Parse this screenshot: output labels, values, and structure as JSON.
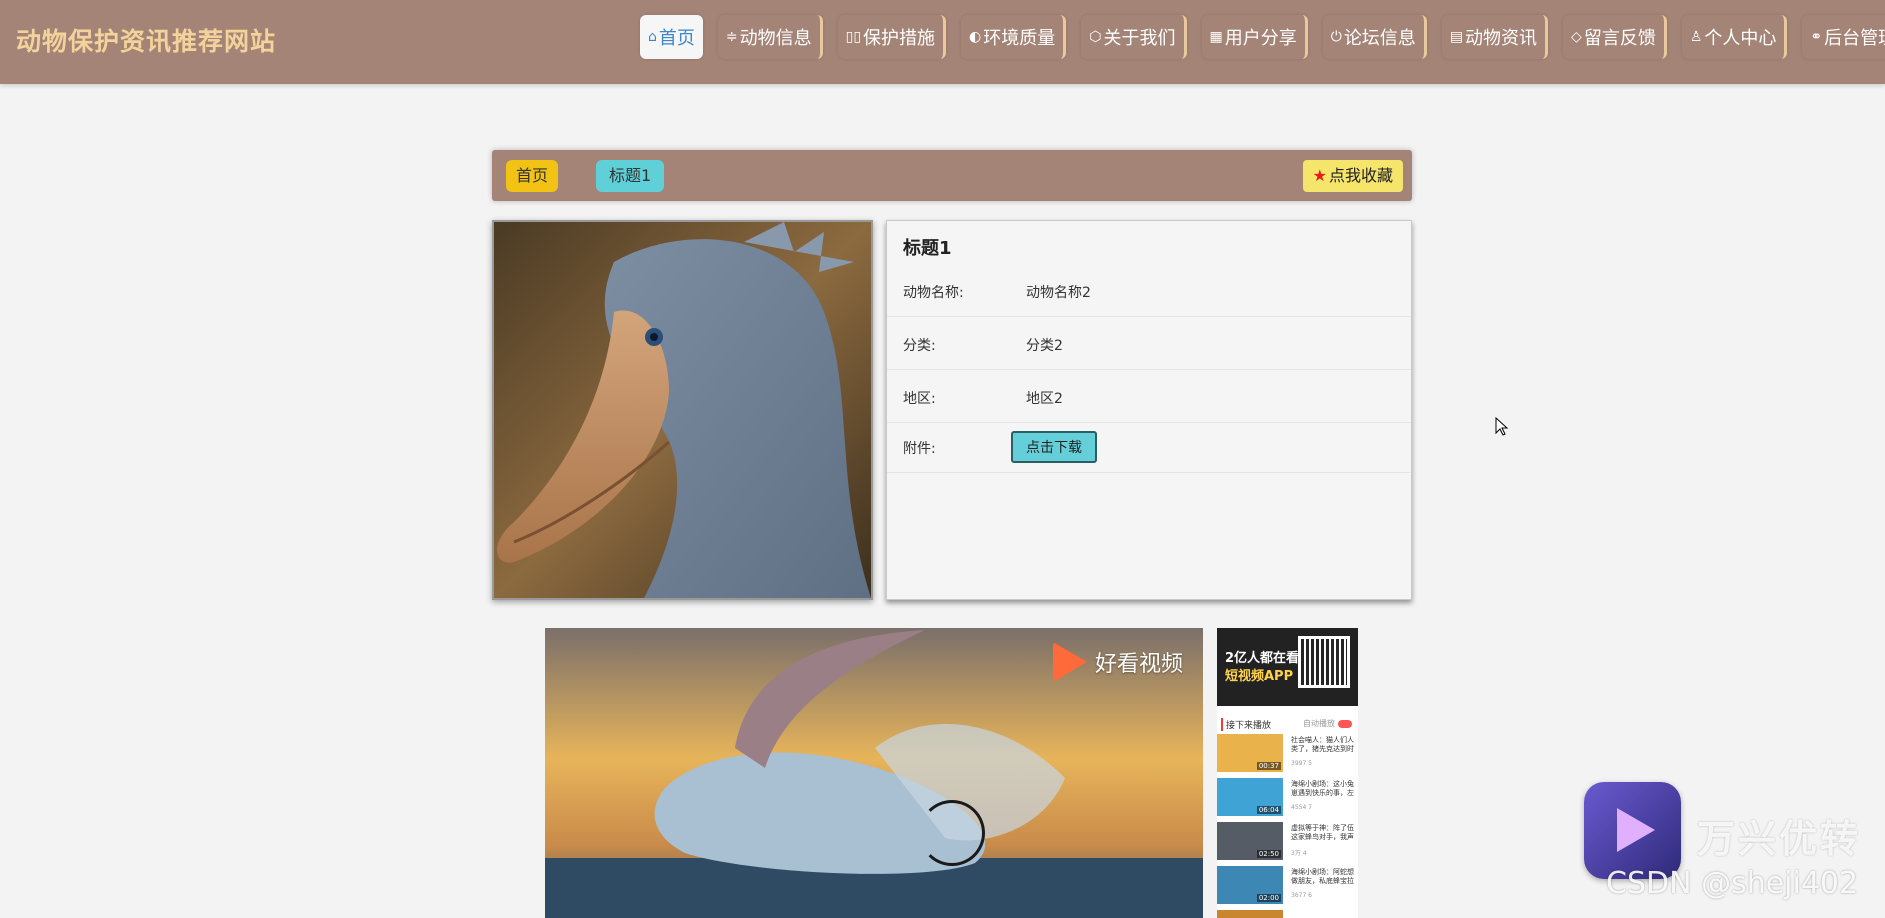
{
  "header": {
    "site_title": "动物保护资讯推荐网站",
    "nav": [
      {
        "label": "首页",
        "icon": "home-icon"
      },
      {
        "label": "动物信息",
        "icon": "sliders-icon"
      },
      {
        "label": "保护措施",
        "icon": "pause-icon"
      },
      {
        "label": "环境质量",
        "icon": "palette-icon"
      },
      {
        "label": "关于我们",
        "icon": "box-icon"
      },
      {
        "label": "用户分享",
        "icon": "grid-icon"
      },
      {
        "label": "论坛信息",
        "icon": "power-icon"
      },
      {
        "label": "动物资讯",
        "icon": "calendar-icon"
      },
      {
        "label": "留言反馈",
        "icon": "tag-icon"
      },
      {
        "label": "个人中心",
        "icon": "user-icon"
      },
      {
        "label": "后台管理",
        "icon": "link-icon"
      }
    ],
    "active_index": 0
  },
  "breadcrumb": {
    "home": "首页",
    "current": "标题1",
    "favorite": "点我收藏"
  },
  "detail": {
    "title": "标题1",
    "rows": [
      {
        "label": "动物名称:",
        "value": "动物名称2"
      },
      {
        "label": "分类:",
        "value": "分类2"
      },
      {
        "label": "地区:",
        "value": "地区2"
      },
      {
        "label": "附件:",
        "button": "点击下载"
      }
    ]
  },
  "video": {
    "brand": "好看视频",
    "sidebar": {
      "ad_line1": "2亿人都在看的",
      "ad_line2": "短视频APP",
      "next_label": "接下来播放",
      "autoplay_label": "自动播放",
      "items": [
        {
          "title": "社会喵人：猫人们人类了，猪先克达到时候...",
          "duration": "00:37",
          "meta": "3997  5"
        },
        {
          "title": "海绵小剧场：这小兔崽遇到快乐的事，左下...",
          "duration": "06:04",
          "meta": "4554  7"
        },
        {
          "title": "虚拟等于神：阵了伍这家蜂鸟对手，我声从...",
          "duration": "02:50",
          "meta": "3万  4"
        },
        {
          "title": "海绵小剧场：阿蛇想做朋友，私底蜂宝拉起...",
          "duration": "02:00",
          "meta": "3677  6"
        }
      ]
    }
  },
  "watermark": {
    "brand": "万兴优转",
    "csdn": "CSDN @sheji402"
  },
  "colors": {
    "header_bg": "#a48477",
    "title_color": "#f3d39b",
    "home_crumb": "#f2c314",
    "title_crumb": "#5fd0d8",
    "fav_btn": "#f5e56b",
    "download_btn": "#65cfd9"
  }
}
